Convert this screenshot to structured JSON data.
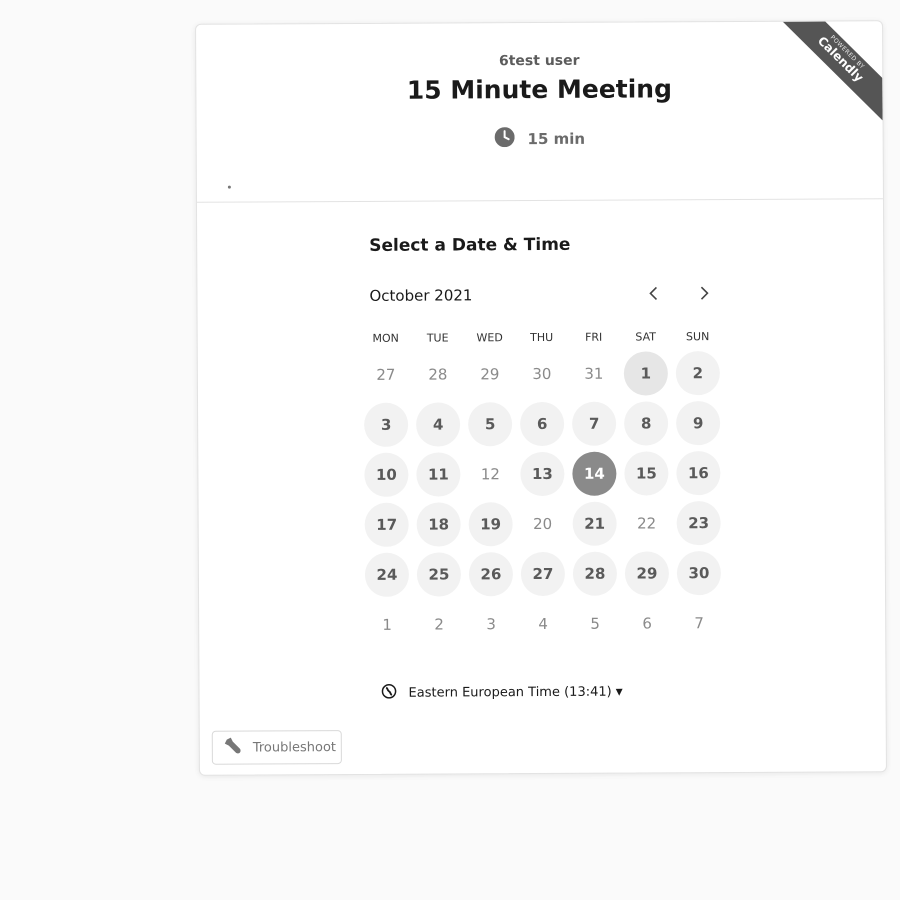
{
  "header": {
    "owner": "6test user",
    "title": "15 Minute Meeting",
    "duration": "15 min",
    "ribbon_small": "POWERED BY",
    "ribbon_brand": "Calendly"
  },
  "calendar": {
    "section_title": "Select a Date & Time",
    "month": "October 2021",
    "prev_icon": "chevron-left-icon",
    "next_icon": "chevron-right-icon",
    "weekdays": [
      "MON",
      "TUE",
      "WED",
      "THU",
      "FRI",
      "SAT",
      "SUN"
    ],
    "days": [
      {
        "label": "27",
        "state": "outside"
      },
      {
        "label": "28",
        "state": "outside"
      },
      {
        "label": "29",
        "state": "outside"
      },
      {
        "label": "30",
        "state": "outside"
      },
      {
        "label": "31",
        "state": "outside"
      },
      {
        "label": "1",
        "state": "today"
      },
      {
        "label": "2",
        "state": "available"
      },
      {
        "label": "3",
        "state": "available"
      },
      {
        "label": "4",
        "state": "available"
      },
      {
        "label": "5",
        "state": "available"
      },
      {
        "label": "6",
        "state": "available"
      },
      {
        "label": "7",
        "state": "available"
      },
      {
        "label": "8",
        "state": "available"
      },
      {
        "label": "9",
        "state": "available"
      },
      {
        "label": "10",
        "state": "available"
      },
      {
        "label": "11",
        "state": "available"
      },
      {
        "label": "12",
        "state": "unavailable"
      },
      {
        "label": "13",
        "state": "available"
      },
      {
        "label": "14",
        "state": "selected"
      },
      {
        "label": "15",
        "state": "available"
      },
      {
        "label": "16",
        "state": "available"
      },
      {
        "label": "17",
        "state": "available"
      },
      {
        "label": "18",
        "state": "available"
      },
      {
        "label": "19",
        "state": "available"
      },
      {
        "label": "20",
        "state": "unavailable"
      },
      {
        "label": "21",
        "state": "available"
      },
      {
        "label": "22",
        "state": "unavailable"
      },
      {
        "label": "23",
        "state": "available"
      },
      {
        "label": "24",
        "state": "available"
      },
      {
        "label": "25",
        "state": "available"
      },
      {
        "label": "26",
        "state": "available"
      },
      {
        "label": "27",
        "state": "available"
      },
      {
        "label": "28",
        "state": "available"
      },
      {
        "label": "29",
        "state": "available"
      },
      {
        "label": "30",
        "state": "available"
      },
      {
        "label": "1",
        "state": "outside"
      },
      {
        "label": "2",
        "state": "outside"
      },
      {
        "label": "3",
        "state": "outside"
      },
      {
        "label": "4",
        "state": "outside"
      },
      {
        "label": "5",
        "state": "outside"
      },
      {
        "label": "6",
        "state": "outside"
      },
      {
        "label": "7",
        "state": "outside"
      }
    ]
  },
  "timezone": {
    "label": "Eastern European Time (13:41)",
    "icon": "globe-icon"
  },
  "troubleshoot": {
    "label": "Troubleshoot",
    "icon": "wrench-icon"
  },
  "colors": {
    "page_bg": "#fafafa",
    "card_bg": "#ffffff",
    "available_bg": "#f2f2f2",
    "selected_bg": "#8a8a8a",
    "ribbon_bg": "#555555"
  }
}
